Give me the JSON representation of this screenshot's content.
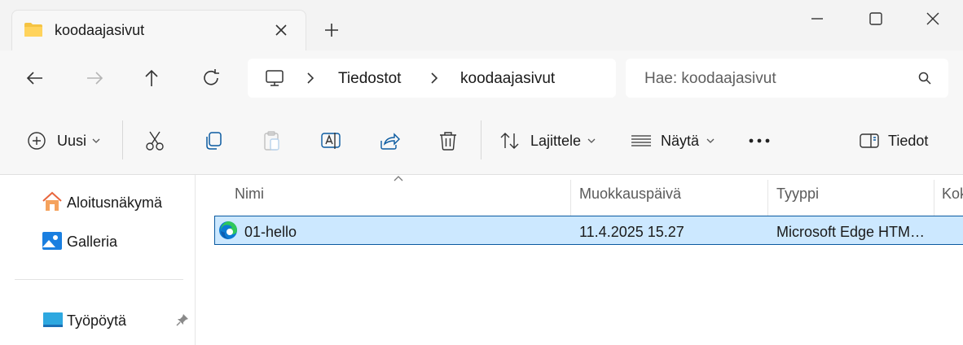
{
  "tab": {
    "title": "koodaajasivut"
  },
  "address": {
    "segments": [
      "Tiedostot",
      "koodaajasivut"
    ]
  },
  "search": {
    "placeholder": "Hae: koodaajasivut"
  },
  "toolbar": {
    "new_label": "Uusi",
    "sort_label": "Lajittele",
    "view_label": "Näytä",
    "details_label": "Tiedot"
  },
  "sidebar": {
    "items": [
      {
        "label": "Aloitusnäkymä",
        "icon": "home-icon"
      },
      {
        "label": "Galleria",
        "icon": "gallery-icon"
      },
      {
        "label": "Työpöytä",
        "icon": "desktop-icon",
        "pinned": true
      }
    ]
  },
  "columns": [
    "Nimi",
    "Muokkauspäivä",
    "Tyyppi",
    "Koko"
  ],
  "files": [
    {
      "name": "01-hello",
      "modified": "11.4.2025 15.27",
      "type": "Microsoft Edge HTM…",
      "icon": "edge-icon",
      "selected": true
    }
  ],
  "colors": {
    "selection_bg": "#cce8ff",
    "selection_border": "#0a5aa0",
    "accent": "#0067c0"
  }
}
